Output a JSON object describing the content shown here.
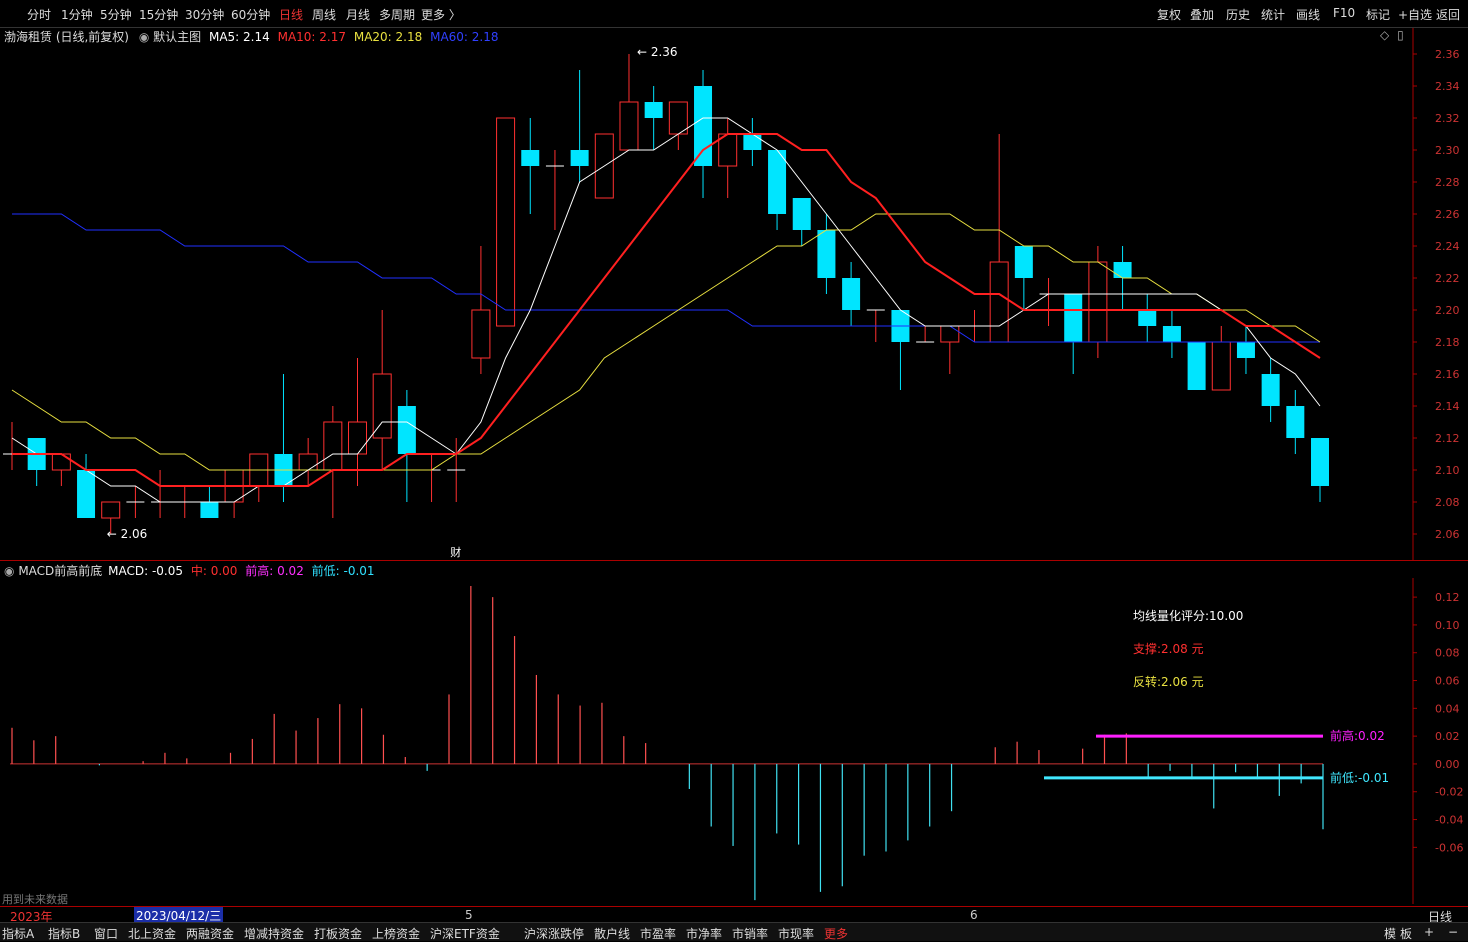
{
  "toolbar": {
    "periods": [
      "分时",
      "1分钟",
      "5分钟",
      "15分钟",
      "30分钟",
      "60分钟",
      "日线",
      "周线",
      "月线",
      "多周期",
      "更多 〉"
    ],
    "active_period": "日线",
    "right_tools": [
      "复权",
      "叠加",
      "历史",
      "统计",
      "画线",
      "F10",
      "标记",
      "+自选",
      "返回"
    ]
  },
  "main_info": {
    "stock": "渤海租赁 (日线,前复权)",
    "template": "默认主图",
    "ma5": "MA5: 2.14",
    "ma10": "MA10: 2.17",
    "ma20": "MA20: 2.18",
    "ma60": "MA60: 2.18",
    "colors": {
      "ma5": "#ffffff",
      "ma10": "#ff2020",
      "ma20": "#e8e040",
      "ma60": "#2030ff",
      "up": "#ff3030",
      "down": "#00e5ff"
    }
  },
  "annotations": {
    "high": "2.36",
    "low": "2.06",
    "fin_mark": "财"
  },
  "macd_info": {
    "name": "MACD前高前底",
    "macd": "MACD: -0.05",
    "mid": "中: 0.00",
    "prev_high": "前高: 0.02",
    "prev_low": "前低: -0.01"
  },
  "macd_notes": {
    "score": "均线量化评分:10.00",
    "support": "支撑:2.08 元",
    "reversal": "反转:2.06 元",
    "high_label": "前高:0.02",
    "low_label": "前低:-0.01"
  },
  "footer": {
    "future_data": "用到未来数据",
    "year": "2023年",
    "cursor_date": "2023/04/12/三",
    "month5": "5",
    "month6": "6",
    "period_label": "日线"
  },
  "bottom_tabs": [
    "指标A",
    "指标B",
    "窗口",
    "北上资金",
    "两融资金",
    "增减持资金",
    "打板资金",
    "上榜资金",
    "沪深ETF资金",
    "沪深涨跌停",
    "散户线",
    "市盈率",
    "市净率",
    "市销率",
    "市现率",
    "更多"
  ],
  "bottom_right": [
    "模",
    "板",
    "+",
    "−"
  ],
  "chart_data": [
    {
      "type": "candlestick",
      "title": "渤海租赁 (日线,前复权)",
      "ylim": [
        2.05,
        2.37
      ],
      "y_ticks": [
        "2.36",
        "2.34",
        "2.32",
        "2.30",
        "2.28",
        "2.26",
        "2.24",
        "2.22",
        "2.20",
        "2.18",
        "2.16",
        "2.14",
        "2.12",
        "2.10",
        "2.08",
        "2.06"
      ],
      "candles": [
        [
          2.11,
          2.11,
          2.13,
          2.1
        ],
        [
          2.12,
          2.1,
          2.12,
          2.09
        ],
        [
          2.1,
          2.11,
          2.11,
          2.09
        ],
        [
          2.1,
          2.07,
          2.11,
          2.07
        ],
        [
          2.07,
          2.08,
          2.08,
          2.06
        ],
        [
          2.08,
          2.08,
          2.09,
          2.07
        ],
        [
          2.08,
          2.08,
          2.1,
          2.07
        ],
        [
          2.08,
          2.08,
          2.09,
          2.07
        ],
        [
          2.08,
          2.07,
          2.09,
          2.07
        ],
        [
          2.08,
          2.1,
          2.1,
          2.07
        ],
        [
          2.09,
          2.11,
          2.11,
          2.08
        ],
        [
          2.11,
          2.09,
          2.16,
          2.08
        ],
        [
          2.1,
          2.11,
          2.12,
          2.09
        ],
        [
          2.1,
          2.13,
          2.14,
          2.07
        ],
        [
          2.11,
          2.13,
          2.17,
          2.09
        ],
        [
          2.12,
          2.16,
          2.2,
          2.1
        ],
        [
          2.14,
          2.11,
          2.15,
          2.08
        ],
        [
          2.1,
          2.1,
          2.11,
          2.08
        ],
        [
          2.1,
          2.1,
          2.12,
          2.08
        ],
        [
          2.17,
          2.2,
          2.24,
          2.16
        ],
        [
          2.19,
          2.32,
          2.32,
          2.19
        ],
        [
          2.3,
          2.29,
          2.32,
          2.26
        ],
        [
          2.29,
          2.29,
          2.3,
          2.25
        ],
        [
          2.3,
          2.29,
          2.35,
          2.28
        ],
        [
          2.27,
          2.31,
          2.31,
          2.28
        ],
        [
          2.3,
          2.33,
          2.36,
          2.3
        ],
        [
          2.33,
          2.32,
          2.34,
          2.3
        ],
        [
          2.31,
          2.33,
          2.33,
          2.3
        ],
        [
          2.34,
          2.29,
          2.35,
          2.27
        ],
        [
          2.29,
          2.31,
          2.32,
          2.27
        ],
        [
          2.31,
          2.3,
          2.32,
          2.29
        ],
        [
          2.3,
          2.26,
          2.3,
          2.25
        ],
        [
          2.27,
          2.25,
          2.27,
          2.24
        ],
        [
          2.25,
          2.22,
          2.26,
          2.21
        ],
        [
          2.22,
          2.2,
          2.23,
          2.19
        ],
        [
          2.2,
          2.2,
          2.2,
          2.18
        ],
        [
          2.2,
          2.18,
          2.2,
          2.15
        ],
        [
          2.18,
          2.18,
          2.19,
          2.18
        ],
        [
          2.18,
          2.19,
          2.19,
          2.16
        ],
        [
          2.19,
          2.19,
          2.2,
          2.18
        ],
        [
          2.18,
          2.23,
          2.31,
          2.18
        ],
        [
          2.24,
          2.22,
          2.24,
          2.2
        ],
        [
          2.21,
          2.21,
          2.22,
          2.19
        ],
        [
          2.21,
          2.18,
          2.21,
          2.16
        ],
        [
          2.18,
          2.23,
          2.24,
          2.17
        ],
        [
          2.23,
          2.22,
          2.24,
          2.2
        ],
        [
          2.2,
          2.19,
          2.21,
          2.18
        ],
        [
          2.19,
          2.18,
          2.2,
          2.17
        ],
        [
          2.18,
          2.15,
          2.18,
          2.15
        ],
        [
          2.15,
          2.18,
          2.19,
          2.15
        ],
        [
          2.18,
          2.17,
          2.19,
          2.16
        ],
        [
          2.16,
          2.14,
          2.17,
          2.13
        ],
        [
          2.14,
          2.12,
          2.15,
          2.11
        ],
        [
          2.12,
          2.09,
          2.12,
          2.08
        ]
      ],
      "ma5": [
        2.12,
        2.11,
        2.11,
        2.1,
        2.09,
        2.09,
        2.08,
        2.08,
        2.08,
        2.08,
        2.09,
        2.09,
        2.1,
        2.11,
        2.11,
        2.13,
        2.13,
        2.12,
        2.11,
        2.13,
        2.17,
        2.2,
        2.24,
        2.28,
        2.29,
        2.3,
        2.3,
        2.31,
        2.32,
        2.32,
        2.31,
        2.3,
        2.28,
        2.26,
        2.24,
        2.22,
        2.2,
        2.19,
        2.19,
        2.19,
        2.19,
        2.2,
        2.21,
        2.21,
        2.21,
        2.21,
        2.21,
        2.21,
        2.21,
        2.2,
        2.19,
        2.17,
        2.16,
        2.14
      ],
      "ma10": [
        2.11,
        2.11,
        2.11,
        2.1,
        2.1,
        2.1,
        2.09,
        2.09,
        2.09,
        2.09,
        2.09,
        2.09,
        2.09,
        2.1,
        2.1,
        2.1,
        2.11,
        2.11,
        2.11,
        2.12,
        2.14,
        2.16,
        2.18,
        2.2,
        2.22,
        2.24,
        2.26,
        2.28,
        2.3,
        2.31,
        2.31,
        2.31,
        2.3,
        2.3,
        2.28,
        2.27,
        2.25,
        2.23,
        2.22,
        2.21,
        2.21,
        2.2,
        2.2,
        2.2,
        2.2,
        2.2,
        2.2,
        2.2,
        2.2,
        2.2,
        2.19,
        2.19,
        2.18,
        2.17
      ],
      "ma20": [
        2.15,
        2.14,
        2.13,
        2.13,
        2.12,
        2.12,
        2.11,
        2.11,
        2.1,
        2.1,
        2.1,
        2.1,
        2.1,
        2.1,
        2.1,
        2.1,
        2.1,
        2.1,
        2.11,
        2.11,
        2.12,
        2.13,
        2.14,
        2.15,
        2.17,
        2.18,
        2.19,
        2.2,
        2.21,
        2.22,
        2.23,
        2.24,
        2.24,
        2.25,
        2.25,
        2.26,
        2.26,
        2.26,
        2.26,
        2.25,
        2.25,
        2.24,
        2.24,
        2.23,
        2.23,
        2.22,
        2.22,
        2.21,
        2.21,
        2.2,
        2.2,
        2.19,
        2.19,
        2.18
      ],
      "ma60": [
        2.26,
        2.26,
        2.26,
        2.25,
        2.25,
        2.25,
        2.25,
        2.24,
        2.24,
        2.24,
        2.24,
        2.24,
        2.23,
        2.23,
        2.23,
        2.22,
        2.22,
        2.22,
        2.21,
        2.21,
        2.2,
        2.2,
        2.2,
        2.2,
        2.2,
        2.2,
        2.2,
        2.2,
        2.2,
        2.2,
        2.19,
        2.19,
        2.19,
        2.19,
        2.19,
        2.19,
        2.19,
        2.19,
        2.19,
        2.18,
        2.18,
        2.18,
        2.18,
        2.18,
        2.18,
        2.18,
        2.18,
        2.18,
        2.18,
        2.18,
        2.18,
        2.18,
        2.18,
        2.18
      ]
    },
    {
      "type": "bar",
      "title": "MACD前高前底",
      "ylim": [
        -0.095,
        0.128
      ],
      "y_ticks": [
        "0.12",
        "0.10",
        "0.08",
        "0.06",
        "0.04",
        "0.02",
        "0.00",
        "-0.02",
        "-0.04",
        "-0.06"
      ],
      "values": [
        0.026,
        0.017,
        0.02,
        0.0,
        -0.001,
        0.0,
        0.002,
        0.008,
        0.004,
        0.0,
        0.008,
        0.018,
        0.036,
        0.024,
        0.033,
        0.043,
        0.04,
        0.021,
        0.005,
        -0.005,
        0.05,
        0.128,
        0.12,
        0.092,
        0.064,
        0.05,
        0.042,
        0.044,
        0.02,
        0.015,
        0.0,
        -0.018,
        -0.045,
        -0.059,
        -0.098,
        -0.05,
        -0.058,
        -0.092,
        -0.088,
        -0.066,
        -0.063,
        -0.055,
        -0.045,
        -0.034,
        0.0,
        0.012,
        0.016,
        0.01,
        0.0,
        0.011,
        0.021,
        0.022,
        -0.01,
        -0.005,
        -0.011,
        -0.032,
        -0.006,
        -0.011,
        -0.023,
        -0.014,
        -0.047
      ],
      "prev_high": 0.02,
      "prev_low": -0.01
    }
  ]
}
